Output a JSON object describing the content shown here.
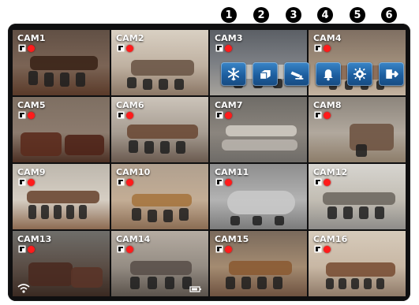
{
  "cameras": [
    {
      "label": "CAM1"
    },
    {
      "label": "CAM2"
    },
    {
      "label": "CAM3"
    },
    {
      "label": "CAM4"
    },
    {
      "label": "CAM5"
    },
    {
      "label": "CAM6"
    },
    {
      "label": "CAM7"
    },
    {
      "label": "CAM8"
    },
    {
      "label": "CAM9"
    },
    {
      "label": "CAM10"
    },
    {
      "label": "CAM11"
    },
    {
      "label": "CAM12"
    },
    {
      "label": "CAM13"
    },
    {
      "label": "CAM14"
    },
    {
      "label": "CAM15"
    },
    {
      "label": "CAM16"
    }
  ],
  "callouts": [
    "1",
    "2",
    "3",
    "4",
    "5",
    "6"
  ],
  "toolbar": {
    "buttons": [
      {
        "icon": "snowflake-icon"
      },
      {
        "icon": "layout-icon"
      },
      {
        "icon": "ptz-camera-icon"
      },
      {
        "icon": "bell-icon"
      },
      {
        "icon": "gear-icon"
      },
      {
        "icon": "exit-icon"
      }
    ],
    "accent": "#1d5e9f"
  },
  "status_colors": {
    "record_dot": "#ff1b1b"
  }
}
